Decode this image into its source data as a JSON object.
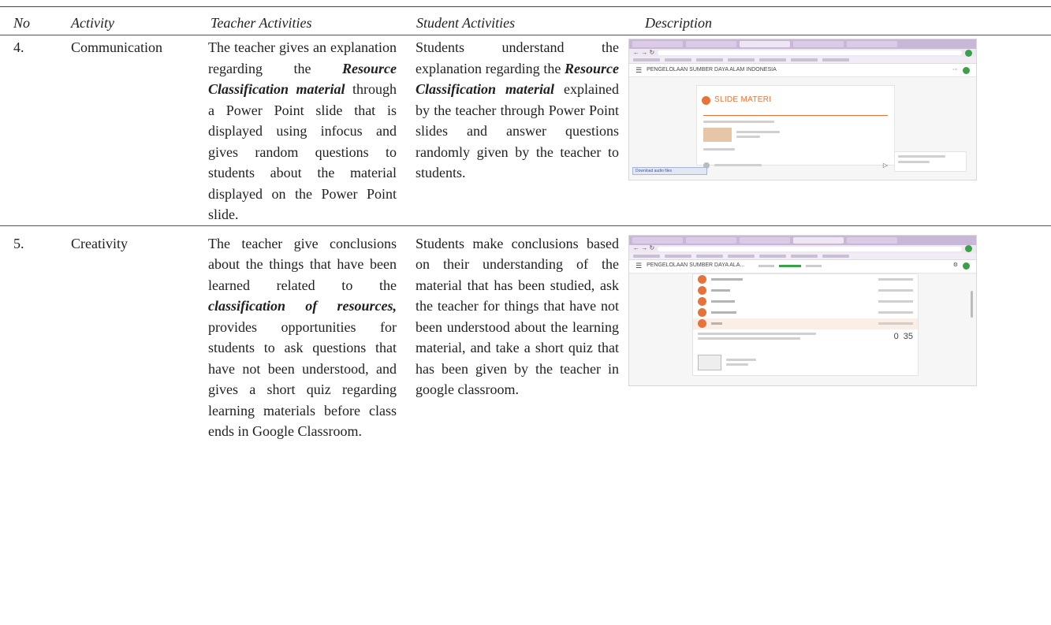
{
  "headers": {
    "no": "No",
    "activity": "Activity",
    "teacher": "Teacher Activities",
    "student": "Student Activities",
    "description": "Description"
  },
  "rows": [
    {
      "no": "4.",
      "activity": "Communication",
      "teacher": {
        "pre": "The teacher gives an explanation regarding the ",
        "emph": "Resource Classification material",
        "post": " through a Power Point slide that is displayed using infocus and gives random questions to students about the material displayed on the Power Point slide."
      },
      "student": {
        "pre": "Students understand the explanation regarding the ",
        "emph": "Resource Classification material",
        "post": " explained by the teacher through Power Point slides and answer questions randomly given by the teacher to students."
      },
      "screenshot": {
        "class_name": "PENGELOLAAN SUMBER DAYA ALAM INDONESIA",
        "title": "SLIDE MATERI",
        "download_bar": "Download audio files"
      }
    },
    {
      "no": "5.",
      "activity": "Creativity",
      "teacher": {
        "pre": "The teacher give conclusions about the things that have been learned related to the ",
        "emph": "classification of resources,",
        "post": " provides opportunities for students to ask questions that have not been understood, and gives a short quiz regarding learning materials before class ends in Google Classroom."
      },
      "student": {
        "pre": "Students make conclusions based on their understanding of the material that has been studied, ask the teacher for things that have not been understood about the learning material, and take a short quiz that has been given by the teacher in google classroom.",
        "emph": "",
        "post": ""
      },
      "screenshot": {
        "class_name": "PENGELOLAAN SUMBER DAYA ALA...",
        "stat_a": "0",
        "stat_b": "35"
      }
    }
  ],
  "colors": {
    "rule": "#444444",
    "classroom_orange": "#e8733a",
    "classroom_green": "#3aa04a"
  }
}
